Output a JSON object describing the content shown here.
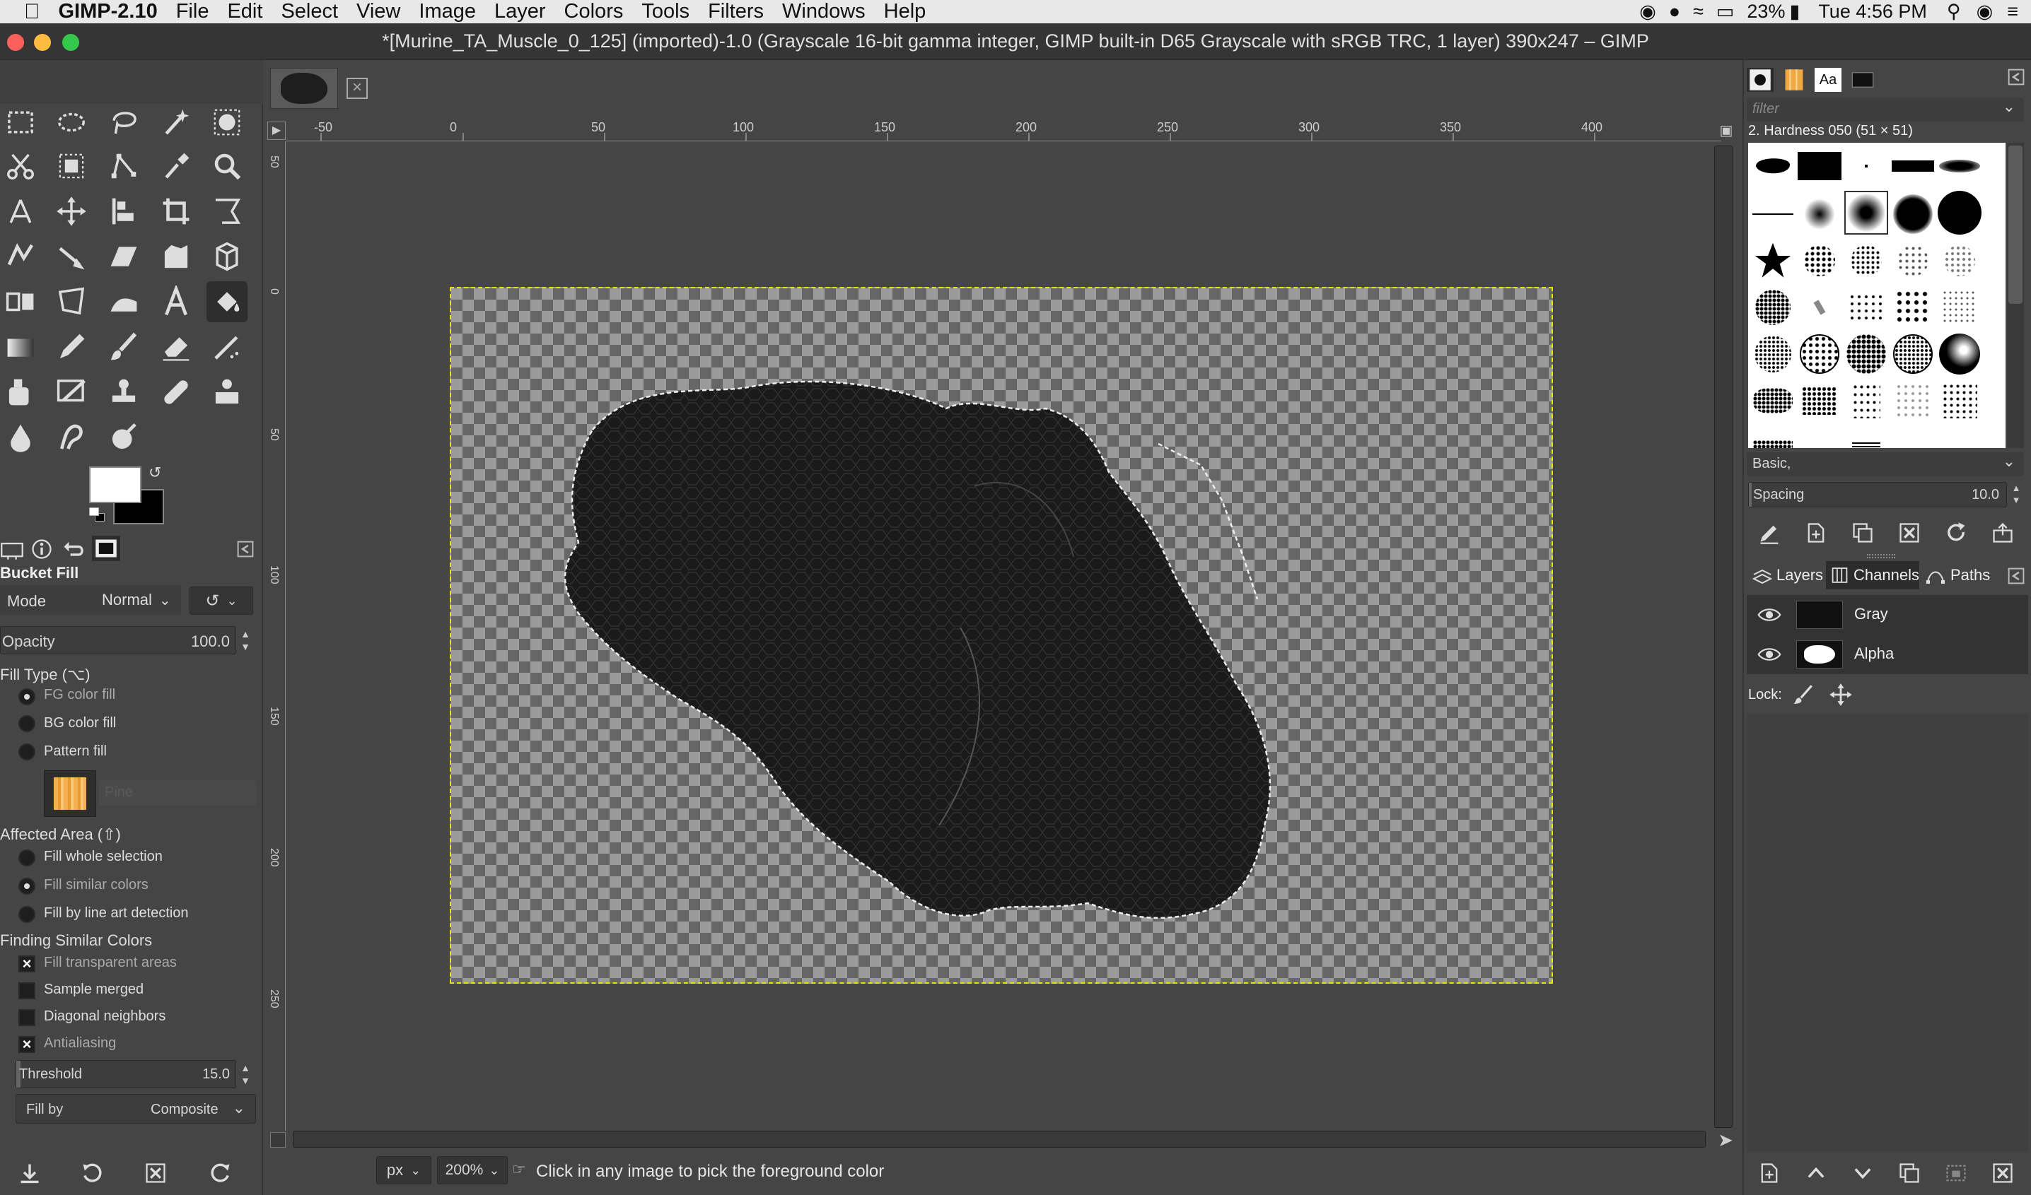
{
  "menubar": {
    "app_name": "GIMP-2.10",
    "items": [
      "File",
      "Edit",
      "Select",
      "View",
      "Image",
      "Layer",
      "Colors",
      "Tools",
      "Filters",
      "Windows",
      "Help"
    ],
    "battery": "23%",
    "clock": "Tue 4:56 PM"
  },
  "window": {
    "title": "*[Murine_TA_Muscle_0_125] (imported)-1.0 (Grayscale 16-bit gamma integer, GIMP built-in D65 Grayscale with sRGB TRC, 1 layer) 390x247 – GIMP"
  },
  "tool_options": {
    "tool_name": "Bucket Fill",
    "mode_label": "Mode",
    "mode_value": "Normal",
    "opacity_label": "Opacity",
    "opacity_value": "100.0",
    "fill_type_label": "Fill Type  (⌥)",
    "fill_types": [
      "FG color fill",
      "BG color fill",
      "Pattern fill"
    ],
    "pattern_name": "Pine",
    "affected_area_label": "Affected Area  (⇧)",
    "affected_areas": [
      "Fill whole selection",
      "Fill similar colors",
      "Fill by line art detection"
    ],
    "finding_label": "Finding Similar Colors",
    "fill_transparent": "Fill transparent areas",
    "sample_merged": "Sample merged",
    "diagonal_neighbors": "Diagonal neighbors",
    "antialiasing": "Antialiasing",
    "threshold_label": "Threshold",
    "threshold_value": "15.0",
    "fill_by_label": "Fill by",
    "fill_by_value": "Composite"
  },
  "ruler": {
    "top_ticks": [
      "-50",
      "0",
      "50",
      "100",
      "150",
      "200",
      "250",
      "300",
      "350",
      "400"
    ],
    "left_ticks": [
      "50",
      "0",
      "50",
      "100",
      "150",
      "200",
      "250"
    ]
  },
  "status": {
    "unit": "px",
    "zoom": "200%",
    "message": "Click in any image to pick the foreground color"
  },
  "brushes": {
    "filter_placeholder": "filter",
    "selected_brush": "2. Hardness 050 (51 × 51)",
    "tag": "Basic,",
    "spacing_label": "Spacing",
    "spacing_value": "10.0"
  },
  "dock_tabs": {
    "layers": "Layers",
    "channels": "Channels",
    "paths": "Paths"
  },
  "channels": [
    {
      "name": "Gray"
    },
    {
      "name": "Alpha"
    }
  ],
  "lock_label": "Lock:",
  "colors": {
    "fg": "#ffffff",
    "bg": "#000000",
    "selection": "#e6e600"
  }
}
